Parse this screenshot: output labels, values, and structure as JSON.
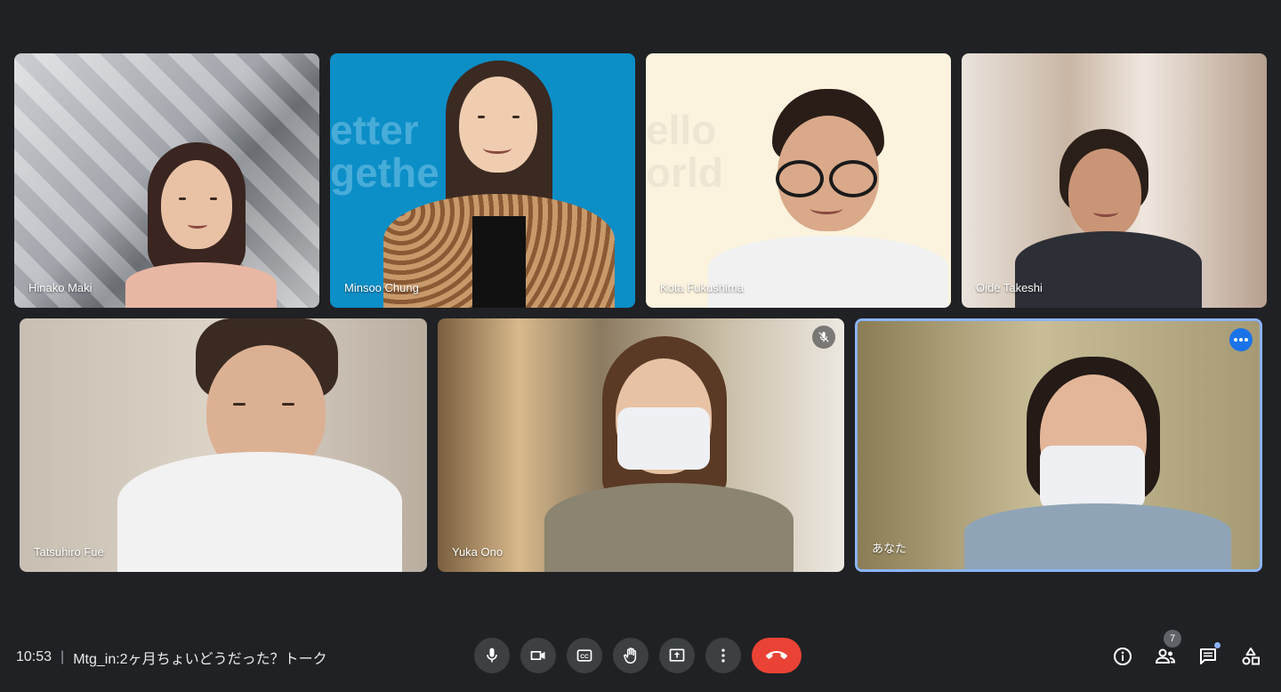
{
  "participants": [
    {
      "name": "Hinako Maki",
      "bg": "#b9bcc2"
    },
    {
      "name": "Minsoo Chung",
      "bg": "#0c8ec7",
      "bg_text": "etter\ngethe"
    },
    {
      "name": "Kota Fukushima",
      "bg": "#fbf3de",
      "bg_text": "ello\norld"
    },
    {
      "name": "Oide Takeshi",
      "bg": "#d8cec4"
    },
    {
      "name": "Tatsuhiro Fue",
      "bg": "#cfc6ba"
    },
    {
      "name": "Yuka Ono",
      "bg": "#9c8a6e",
      "muted": true
    },
    {
      "name": "あなた",
      "bg": "#b7a985",
      "self": true
    }
  ],
  "bottom_bar": {
    "time": "10:53",
    "separator": "|",
    "meeting_title": "Mtg_in:2ヶ月ちょいどうだった？トーク"
  },
  "controls": [
    {
      "icon": "microphone-icon"
    },
    {
      "icon": "camera-icon"
    },
    {
      "icon": "captions-icon"
    },
    {
      "icon": "raise-hand-icon"
    },
    {
      "icon": "present-screen-icon"
    },
    {
      "icon": "more-options-icon"
    },
    {
      "icon": "end-call-icon",
      "color": "#ea4335"
    }
  ],
  "right_panel": {
    "people_count": "7",
    "icons": [
      "info-icon",
      "people-icon",
      "chat-icon",
      "activities-icon"
    ]
  },
  "colors": {
    "accent": "#8ab4f8",
    "background": "#202124",
    "button": "#3c4043"
  }
}
